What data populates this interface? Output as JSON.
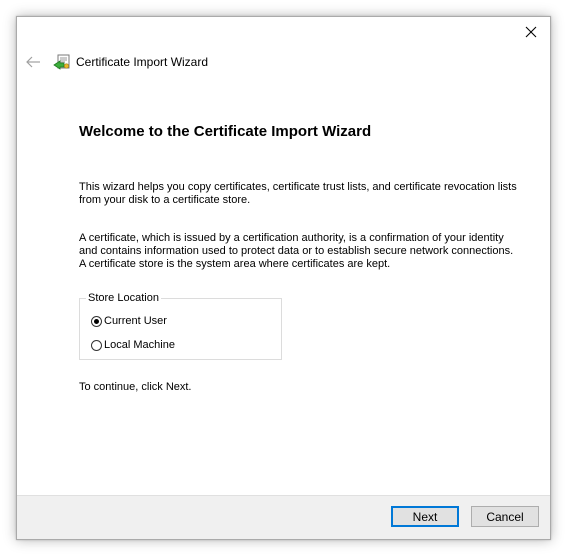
{
  "window": {
    "title": "Certificate Import Wizard"
  },
  "icons": {
    "close": "close-icon",
    "back": "back-arrow-icon",
    "wizard": "certificate-icon"
  },
  "content": {
    "heading": "Welcome to the Certificate Import Wizard",
    "paragraph1": "This wizard helps you copy certificates, certificate trust lists, and certificate revocation lists from your disk to a certificate store.",
    "paragraph2": "A certificate, which is issued by a certification authority, is a confirmation of your identity and contains information used to protect data or to establish secure network connections. A certificate store is the system area where certificates are kept.",
    "store_location": {
      "label": "Store Location",
      "options": [
        {
          "label": "Current User",
          "selected": true
        },
        {
          "label": "Local Machine",
          "selected": false
        }
      ]
    },
    "continue_text": "To continue, click Next."
  },
  "footer": {
    "next_label": "Next",
    "cancel_label": "Cancel"
  },
  "colors": {
    "accent": "#0078d7",
    "footer_bg": "#f0f0f0",
    "button_bg": "#e1e1e1"
  }
}
